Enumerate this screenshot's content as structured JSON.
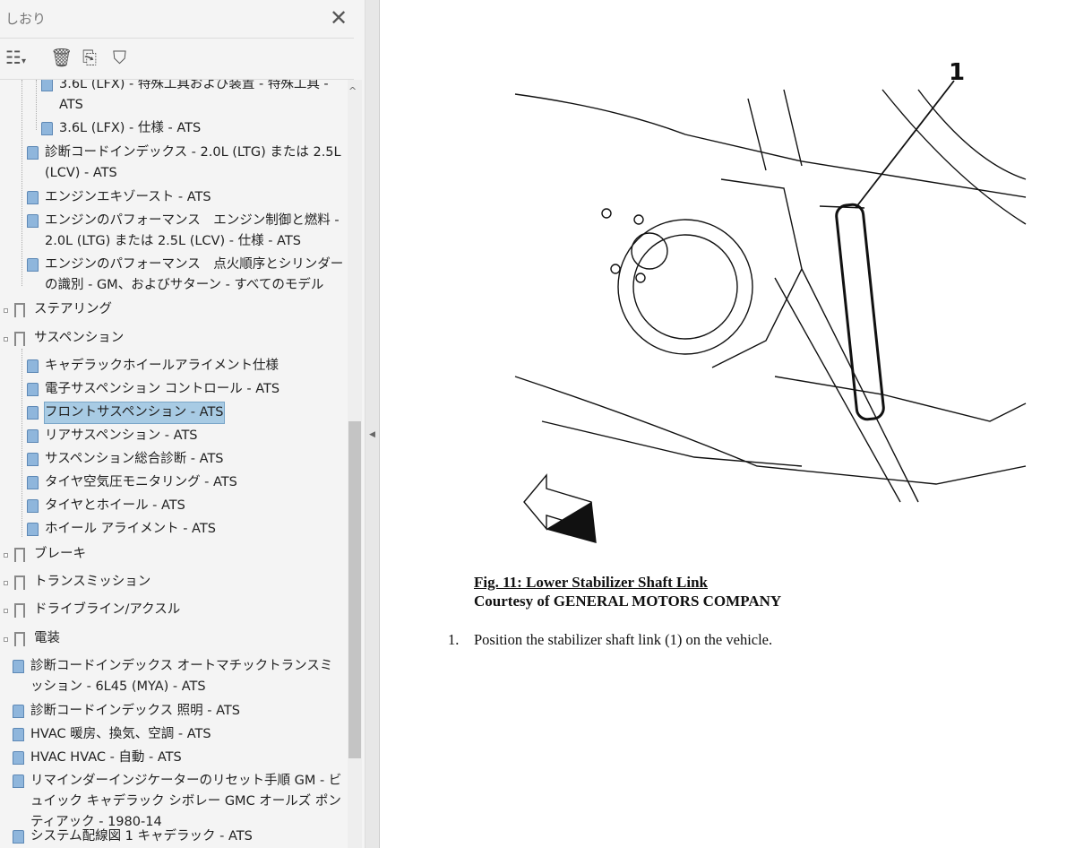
{
  "panel": {
    "title": "しおり",
    "close_icon": "close-icon"
  },
  "toolbar": {
    "icons": [
      "options-menu-icon",
      "delete-icon",
      "new-bookmark-icon",
      "bookmark-expand-icon"
    ]
  },
  "tree": [
    {
      "level": 2,
      "label": "3.6L (LFX) - 特殊工具および装置 - 特殊工具 - ATS",
      "type": "leaf"
    },
    {
      "level": 2,
      "label": "3.6L (LFX) - 仕様 - ATS",
      "type": "leaf"
    },
    {
      "level": 1,
      "label": "診断コードインデックス - 2.0L (LTG) または 2.5L (LCV) - ATS",
      "type": "leaf"
    },
    {
      "level": 1,
      "label": "エンジンエキゾースト - ATS",
      "type": "leaf"
    },
    {
      "level": 1,
      "label": "エンジンのパフォーマンス　エンジン制御と燃料 - 2.0L (LTG) または 2.5L (LCV) - 仕様 - ATS",
      "type": "leaf"
    },
    {
      "level": 1,
      "label": "エンジンのパフォーマンス　点火順序とシリンダーの識別 - GM、およびサターン - すべてのモデル",
      "type": "leaf"
    },
    {
      "level": 0,
      "label": "ステアリング",
      "type": "folder"
    },
    {
      "level": 0,
      "label": "サスペンション",
      "type": "folder"
    },
    {
      "level": 1,
      "label": "キャデラックホイールアライメント仕様",
      "type": "leaf"
    },
    {
      "level": 1,
      "label": "電子サスペンション コントロール - ATS",
      "type": "leaf"
    },
    {
      "level": 1,
      "label": "フロントサスペンション - ATS",
      "type": "leaf",
      "selected": true
    },
    {
      "level": 1,
      "label": "リアサスペンション - ATS",
      "type": "leaf"
    },
    {
      "level": 1,
      "label": "サスペンション総合診断 - ATS",
      "type": "leaf"
    },
    {
      "level": 1,
      "label": "タイヤ空気圧モニタリング - ATS",
      "type": "leaf"
    },
    {
      "level": 1,
      "label": "タイヤとホイール - ATS",
      "type": "leaf"
    },
    {
      "level": 1,
      "label": "ホイール アライメント - ATS",
      "type": "leaf"
    },
    {
      "level": 0,
      "label": "ブレーキ",
      "type": "folder"
    },
    {
      "level": 0,
      "label": "トランスミッション",
      "type": "folder"
    },
    {
      "level": 0,
      "label": "ドライブライン/アクスル",
      "type": "folder"
    },
    {
      "level": 0,
      "label": "電装",
      "type": "folder"
    },
    {
      "level": 0,
      "label": "診断コードインデックス オートマチックトランスミッション - 6L45 (MYA) - ATS",
      "type": "leaf"
    },
    {
      "level": 0,
      "label": "診断コードインデックス 照明 - ATS",
      "type": "leaf"
    },
    {
      "level": 0,
      "label": "HVAC 暖房、換気、空調 - ATS",
      "type": "leaf"
    },
    {
      "level": 0,
      "label": "HVAC HVAC - 自動 - ATS",
      "type": "leaf"
    },
    {
      "level": 0,
      "label": "リマインダーインジケーターのリセット手順 GM - ビュイック キャデラック シボレー GMC オールズ ポンティアック - 1980-14",
      "type": "leaf"
    },
    {
      "level": 0,
      "label": "システム配線図 1 キャデラック - ATS",
      "type": "leaf"
    }
  ],
  "document": {
    "callout": "1",
    "figure_title": "Fig. 11: Lower Stabilizer Shaft Link",
    "courtesy": "Courtesy of GENERAL MOTORS COMPANY",
    "step_number": "1.",
    "step_text": "Position the stabilizer shaft link (1) on the vehicle."
  }
}
